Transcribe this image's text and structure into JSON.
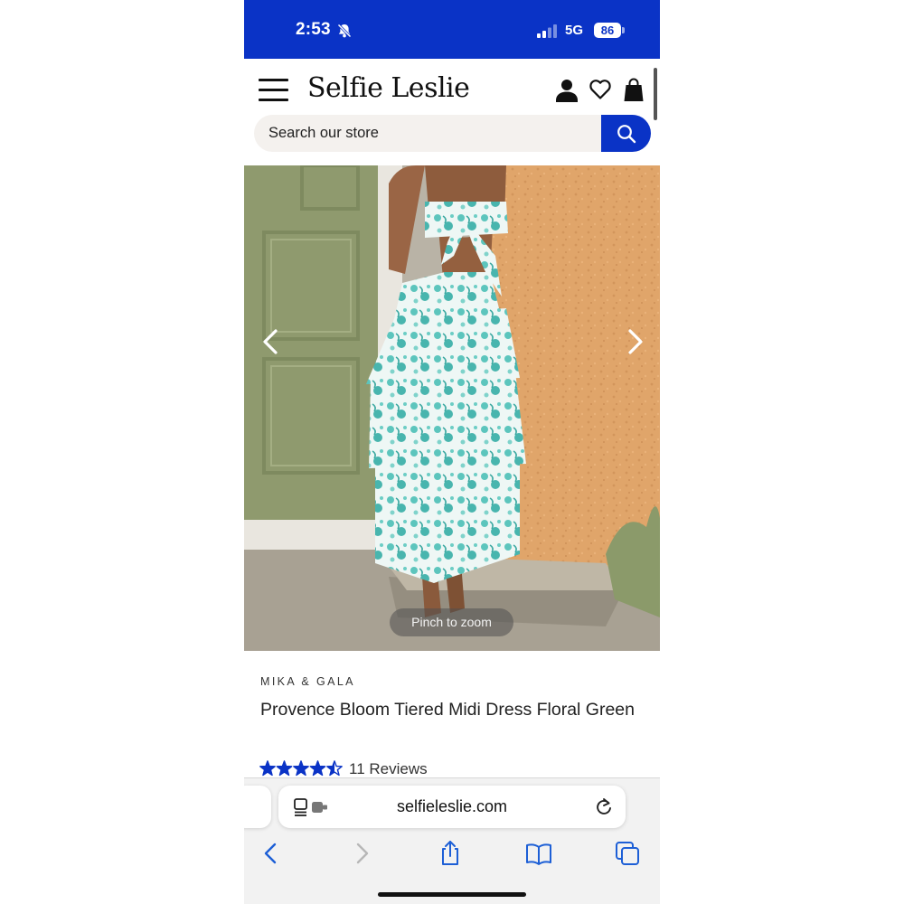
{
  "status_bar": {
    "time": "2:53",
    "network": "5G",
    "battery": "86",
    "colors": {
      "background": "#0a33c6",
      "text": "#ffffff"
    },
    "icons": [
      "bell-slash-icon",
      "cellular-signal-icon",
      "battery-icon"
    ]
  },
  "header": {
    "logo": "Selfie Leslie",
    "icons": [
      "hamburger-menu-icon",
      "account-icon",
      "heart-icon",
      "shopping-bag-icon"
    ]
  },
  "search": {
    "placeholder": "Search our store",
    "button_icon": "search-icon",
    "accent_color": "#0a33c6"
  },
  "gallery": {
    "zoom_hint": "Pinch to zoom",
    "icons": [
      "chevron-left-icon",
      "chevron-right-icon"
    ]
  },
  "product": {
    "brand": "MIKA & GALA",
    "title": "Provence Bloom Tiered Midi Dress Floral Green",
    "rating": 4.5,
    "rating_max": 5,
    "reviews_label": "11 Reviews",
    "star_color": "#0a33c6"
  },
  "browser": {
    "url": "selfieleslie.com",
    "icons": [
      "page-menu-icon",
      "reload-icon",
      "back-icon",
      "forward-icon",
      "share-icon",
      "bookmarks-icon",
      "tabs-icon"
    ]
  }
}
